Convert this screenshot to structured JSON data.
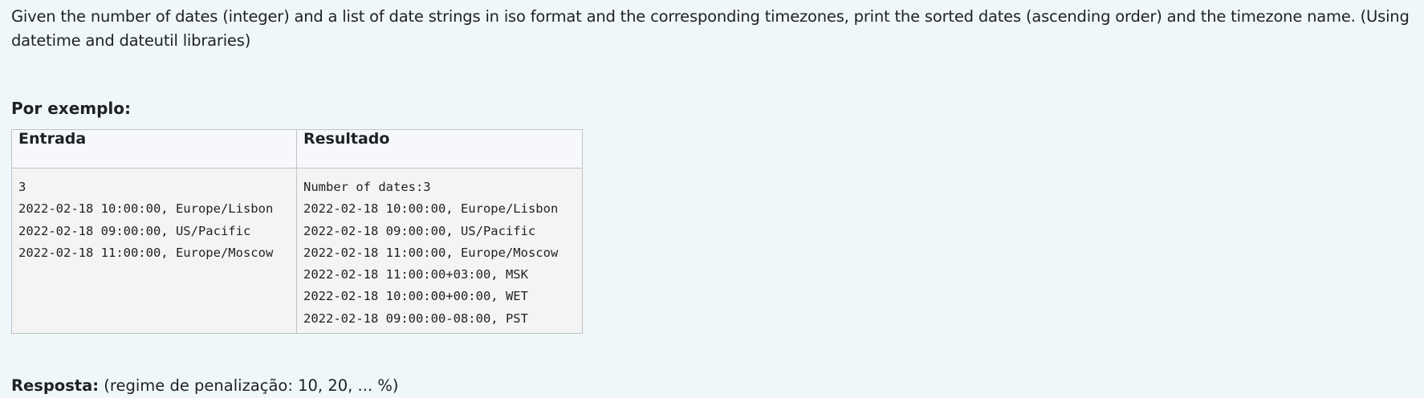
{
  "question": {
    "text": "Given the number of dates (integer) and a list of date strings in iso format and the corresponding timezones, print the sorted dates (ascending order) and the timezone name. (Using datetime and dateutil libraries)"
  },
  "example": {
    "heading": "Por exemplo:",
    "columns": {
      "input": "Entrada",
      "output": "Resultado"
    },
    "input_lines": [
      "3",
      "2022-02-18 10:00:00, Europe/Lisbon",
      "2022-02-18 09:00:00, US/Pacific",
      "2022-02-18 11:00:00, Europe/Moscow"
    ],
    "output_lines": [
      "Number of dates:3",
      "2022-02-18 10:00:00, Europe/Lisbon",
      "2022-02-18 09:00:00, US/Pacific",
      "2022-02-18 11:00:00, Europe/Moscow",
      "2022-02-18 11:00:00+03:00, MSK",
      "2022-02-18 10:00:00+00:00, WET",
      "2022-02-18 09:00:00-08:00, PST"
    ]
  },
  "answer": {
    "label": "Resposta:",
    "penalty": "(regime de penalização: 10, 20, ... %)"
  }
}
